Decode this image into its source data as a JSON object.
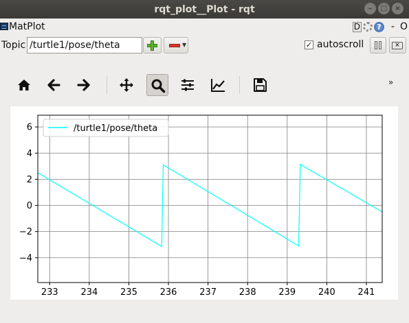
{
  "window": {
    "title": "rqt_plot__Plot - rqt"
  },
  "dock": {
    "title": "MatPlot",
    "d_label": "D",
    "help_label": "?",
    "dash_label": "-",
    "close_label": "O"
  },
  "topic": {
    "label": "Topic",
    "value": "/turtle1/pose/theta"
  },
  "autoscroll": {
    "label": "autoscroll",
    "checked": true
  },
  "toolbar": {
    "icons": [
      "home-icon",
      "back-arrow-icon",
      "forward-arrow-icon",
      "pan-icon",
      "zoom-icon",
      "subplot-config-icon",
      "axes-edit-icon",
      "save-icon"
    ],
    "active": "zoom-icon",
    "more_label": "»"
  },
  "colors": {
    "series": "#00ffff",
    "grid": "#808080",
    "titlebar": "#3c3b37"
  },
  "chart_data": {
    "type": "line",
    "title": "",
    "xlabel": "",
    "ylabel": "",
    "xlim": [
      232.7,
      241.4
    ],
    "ylim": [
      -5.9,
      6.9
    ],
    "xticks": [
      233,
      234,
      235,
      236,
      237,
      238,
      239,
      240,
      241
    ],
    "yticks": [
      -4,
      -2,
      0,
      2,
      4,
      6
    ],
    "ytick_labels": [
      "−4",
      "−2",
      "0",
      "2",
      "4",
      "6"
    ],
    "grid": true,
    "legend_position": "top-left",
    "series": [
      {
        "name": "/turtle1/pose/theta",
        "color": "#00ffff",
        "x": [
          232.7,
          235.83,
          235.83,
          235.87,
          239.29,
          239.29,
          239.33,
          241.4
        ],
        "y": [
          2.5,
          -3.14,
          -3.14,
          3.1,
          -3.1,
          -3.1,
          3.14,
          -0.5
        ]
      }
    ]
  }
}
